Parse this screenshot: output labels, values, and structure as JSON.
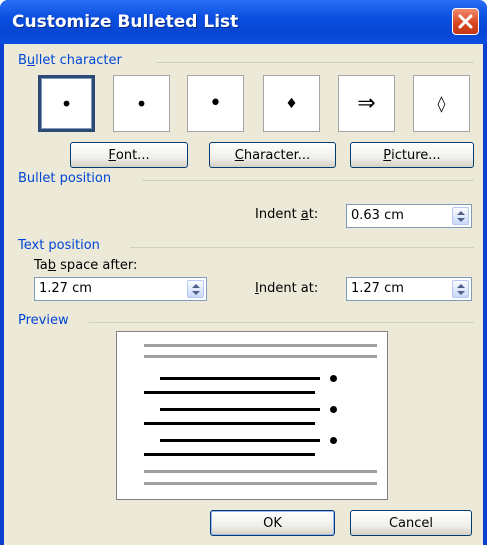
{
  "window": {
    "title": "Customize Bulleted List",
    "close_icon": "close-icon"
  },
  "bullet_character": {
    "label_pre": "B",
    "label_accel": "u",
    "label_post": "llet character",
    "options": [
      {
        "glyph": "•",
        "selected": true
      },
      {
        "glyph": "•",
        "selected": false
      },
      {
        "glyph": "•",
        "selected": false
      },
      {
        "glyph": "♦",
        "selected": false
      },
      {
        "glyph": "⇒",
        "selected": false
      },
      {
        "glyph": "◊",
        "selected": false
      }
    ],
    "font_button": {
      "accel": "F",
      "rest": "ont..."
    },
    "character_button": {
      "accel": "C",
      "rest": "haracter..."
    },
    "picture_button": {
      "accel": "P",
      "rest": "icture..."
    }
  },
  "bullet_position": {
    "label": "Bullet position",
    "indent_label_pre": "Indent ",
    "indent_label_accel": "a",
    "indent_label_post": "t:",
    "indent_value": "0.63 cm"
  },
  "text_position": {
    "label": "Text position",
    "tab_label_pre": "Ta",
    "tab_label_accel": "b",
    "tab_label_post": " space after:",
    "tab_value": "1.27 cm",
    "indent_label_accel": "I",
    "indent_label_post": "ndent at:",
    "indent_value": "1.27 cm"
  },
  "preview": {
    "label": "Preview"
  },
  "footer": {
    "ok_label": "OK",
    "cancel_label": "Cancel"
  }
}
